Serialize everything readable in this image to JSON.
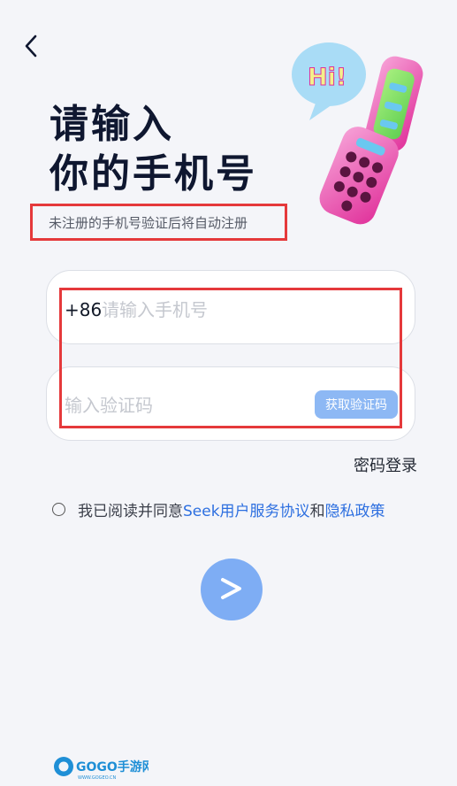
{
  "header": {
    "back_icon": "chevron-left-icon",
    "title_line1": "请输入",
    "title_line2": "你的手机号",
    "hint": "未注册的手机号验证后将自动注册"
  },
  "illustration": {
    "bubble_text": "Hi!"
  },
  "phone_field": {
    "prefix": "+86",
    "placeholder": "请输入手机号",
    "value": ""
  },
  "code_field": {
    "placeholder": "输入验证码",
    "value": "",
    "get_code_label": "获取验证码"
  },
  "password_login": "密码登录",
  "agreement": {
    "checked": false,
    "text_before": "我已阅读并同意",
    "terms_link": "Seek用户服务协议",
    "and_text": "和",
    "privacy_link": "隐私政策"
  },
  "submit": {
    "icon": "arrow-right-icon"
  },
  "watermark": {
    "brand": "GOGO手游网",
    "url": "WWW.GOGEO.CN"
  },
  "colors": {
    "accent": "#2d6fe0",
    "button": "#8db8f4",
    "highlight": "#e5393b",
    "background": "#f4f5f9"
  }
}
